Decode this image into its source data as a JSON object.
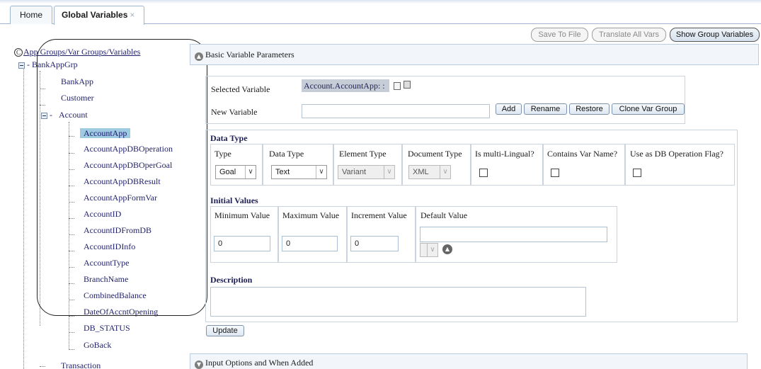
{
  "tabs": [
    {
      "label": "Home"
    },
    {
      "label": "Global Variables",
      "close": "×"
    }
  ],
  "toolbar": {
    "save_to_file": "Save To File",
    "translate_all_vars": "Translate All Vars",
    "show_group_variables": "Show Group Variables"
  },
  "tree": {
    "root_label": "App Groups/Var Groups/Variables",
    "group": "BankAppGrp",
    "children": [
      "BankApp",
      "Customer",
      "Account",
      "Transaction"
    ],
    "account_children": [
      "AccountApp",
      "AccountAppDBOperation",
      "AccountAppDBOperGoal",
      "AccountAppDBResult",
      "AccountAppFormVar",
      "AccountID",
      "AccountIDFromDB",
      "AccountIDInfo",
      "AccountType",
      "BranchName",
      "CombinedBalance",
      "DateOfAccntOpening",
      "DB_STATUS",
      "GoBack"
    ]
  },
  "panels": {
    "basic": "Basic Variable Parameters",
    "input_options": "Input Options and When Added"
  },
  "variable": {
    "selected_label": "Selected Variable",
    "selected_value": "Account.AccountApp: :",
    "new_label": "New Variable",
    "new_value": "",
    "buttons": {
      "add": "Add",
      "rename": "Rename",
      "restore": "Restore",
      "clone": "Clone Var Group"
    }
  },
  "data_type": {
    "heading": "Data Type",
    "columns": [
      "Type",
      "Data Type",
      "Element Type",
      "Document Type",
      "Is multi-Lingual?",
      "Contains Var Name?",
      "Use as DB Operation Flag?"
    ],
    "type_value": "Goal",
    "data_type_value": "Text",
    "element_type_value": "Variant",
    "document_type_value": "XML",
    "is_multilingual": false,
    "contains_var_name": false,
    "use_as_db_flag": false
  },
  "initial_values": {
    "heading": "Initial Values",
    "columns": [
      "Minimum Value",
      "Maximum Value",
      "Increment Value",
      "Default Value"
    ],
    "minimum": "0",
    "maximum": "0",
    "increment": "0",
    "default": ""
  },
  "description": {
    "heading": "Description",
    "value": ""
  },
  "update_label": "Update"
}
